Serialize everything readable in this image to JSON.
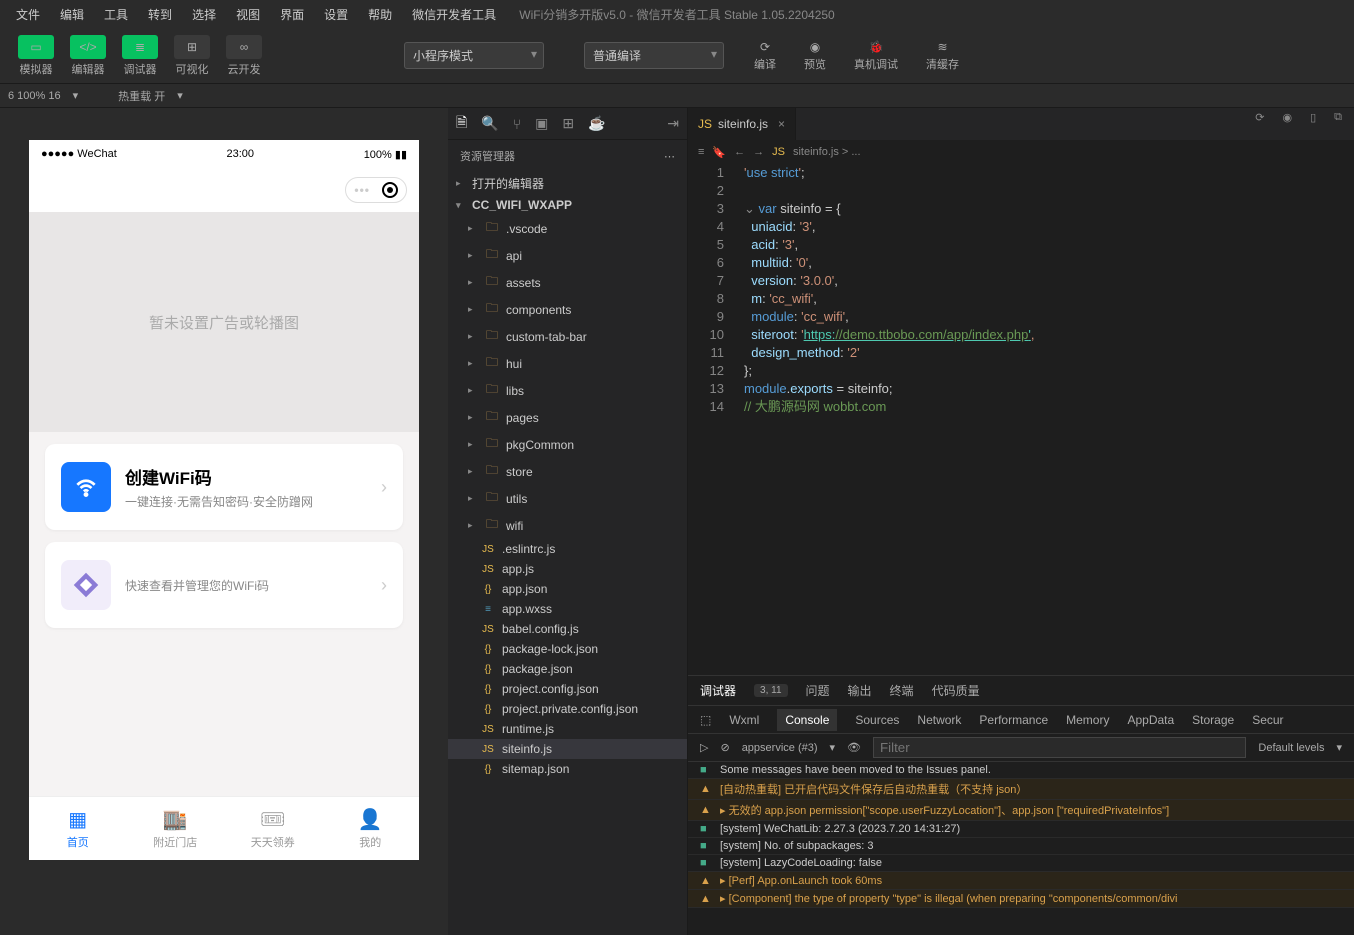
{
  "window": {
    "title": "WiFi分销多开版v5.0 - 微信开发者工具 Stable 1.05.2204250"
  },
  "menubar": [
    "文件",
    "编辑",
    "工具",
    "转到",
    "选择",
    "视图",
    "界面",
    "设置",
    "帮助",
    "微信开发者工具"
  ],
  "toolbar": {
    "simulator": "模拟器",
    "editor": "编辑器",
    "debugger": "调试器",
    "visualize": "可视化",
    "cloud": "云开发",
    "mode": "小程序模式",
    "compile_mode": "普通编译",
    "compile": "编译",
    "preview": "预览",
    "real": "真机调试",
    "clear": "清缓存"
  },
  "statusbar": {
    "scale": "6 100% 16",
    "hotreload": "热重载 开"
  },
  "simulator": {
    "carrier": "WeChat",
    "time": "23:00",
    "battery": "100%",
    "banner": "暂未设置广告或轮播图",
    "card1_title": "创建WiFi码",
    "card1_sub": "一键连接·无需告知密码·安全防蹭网",
    "card2_sub": "快速查看并管理您的WiFi码",
    "tabs": [
      "首页",
      "附近门店",
      "天天领券",
      "我的"
    ]
  },
  "explorer": {
    "title": "资源管理器",
    "section1": "打开的编辑器",
    "project": "CC_WIFI_WXAPP",
    "folders": [
      ".vscode",
      "api",
      "assets",
      "components",
      "custom-tab-bar",
      "hui",
      "libs",
      "pages",
      "pkgCommon",
      "store",
      "utils",
      "wifi"
    ],
    "files": [
      ".eslintrc.js",
      "app.js",
      "app.json",
      "app.wxss",
      "babel.config.js",
      "package-lock.json",
      "package.json",
      "project.config.json",
      "project.private.config.json",
      "runtime.js",
      "siteinfo.js",
      "sitemap.json"
    ]
  },
  "editor": {
    "filename": "siteinfo.js",
    "breadcrumb": "siteinfo.js > ...",
    "lines": [
      "'use strict';",
      "",
      "var siteinfo = {",
      "  uniacid: '3',",
      "  acid: '3',",
      "  multiid: '0',",
      "  version: '3.0.0',",
      "  m: 'cc_wifi',",
      "  module: 'cc_wifi',",
      "  siteroot: 'https://demo.ttbobo.com/app/index.php',",
      "  design_method: '2'",
      "};",
      "module.exports = siteinfo;",
      "// 大鹏源码网 wobbt.com"
    ]
  },
  "debugger": {
    "tabs": [
      "调试器",
      "问题",
      "输出",
      "终端",
      "代码质量"
    ],
    "cursor": "3, 11",
    "devtools": [
      "Wxml",
      "Console",
      "Sources",
      "Network",
      "Performance",
      "Memory",
      "AppData",
      "Storage",
      "Secur"
    ],
    "scope": "appservice (#3)",
    "filter_ph": "Filter",
    "levels": "Default levels",
    "logs": [
      {
        "type": "info",
        "text": "Some messages have been moved to the Issues panel."
      },
      {
        "type": "warn",
        "text": "[自动热重载] 已开启代码文件保存后自动热重载（不支持 json）"
      },
      {
        "type": "warn",
        "text": "▸ 无效的 app.json permission[\"scope.userFuzzyLocation\"]、app.json [\"requiredPrivateInfos\"]"
      },
      {
        "type": "info",
        "text": "[system] WeChatLib: 2.27.3 (2023.7.20 14:31:27)"
      },
      {
        "type": "info",
        "text": "[system] No. of subpackages: 3"
      },
      {
        "type": "info",
        "text": "[system] LazyCodeLoading: false"
      },
      {
        "type": "warn",
        "text": "▸ [Perf] App.onLaunch took 60ms"
      },
      {
        "type": "warn",
        "text": "▸ [Component] the type of property \"type\" is illegal (when preparing \"components/common/divi"
      }
    ]
  }
}
